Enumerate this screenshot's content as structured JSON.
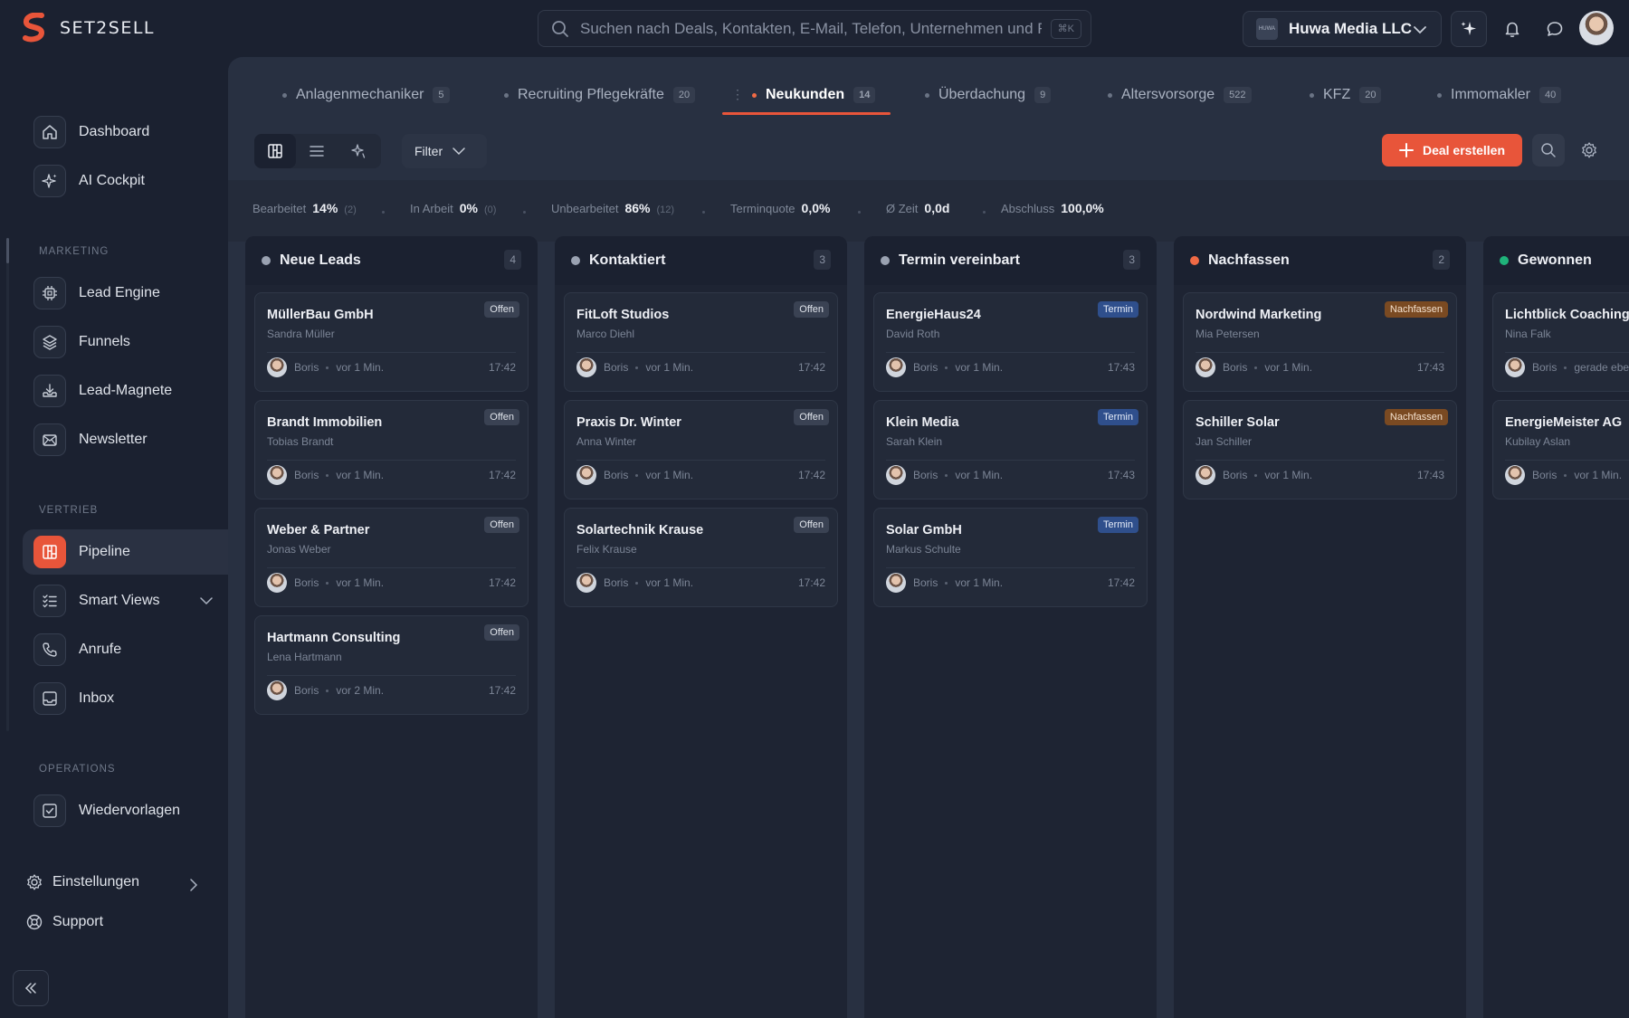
{
  "app": {
    "name": "SET2SELL"
  },
  "search": {
    "placeholder": "Suchen nach Deals, Kontakten, E-Mail, Telefon, Unternehmen und Fi",
    "shortcut": "⌘K"
  },
  "org": {
    "name": "Huwa Media LLC",
    "logo_text": "HUWA"
  },
  "sidebar": {
    "items": [
      {
        "label": "Dashboard"
      },
      {
        "label": "AI Cockpit"
      },
      {
        "label": "Lead Engine"
      },
      {
        "label": "Funnels"
      },
      {
        "label": "Lead-Magnete"
      },
      {
        "label": "Newsletter"
      },
      {
        "label": "Pipeline"
      },
      {
        "label": "Smart Views"
      },
      {
        "label": "Anrufe"
      },
      {
        "label": "Inbox"
      },
      {
        "label": "Wiedervorlagen"
      }
    ],
    "sections": {
      "marketing": "MARKETING",
      "vertrieb": "VERTRIEB",
      "operations": "OPERATIONS"
    },
    "settings": "Einstellungen",
    "support": "Support"
  },
  "tabs": [
    {
      "label": "Anlagenmechaniker",
      "count": "5"
    },
    {
      "label": "Recruiting Pflegekräfte",
      "count": "20"
    },
    {
      "label": "Neukunden",
      "count": "14",
      "active": true
    },
    {
      "label": "Überdachung",
      "count": "9"
    },
    {
      "label": "Altersvorsorge",
      "count": "522"
    },
    {
      "label": "KFZ",
      "count": "20"
    },
    {
      "label": "Immomakler",
      "count": "40"
    }
  ],
  "toolbar": {
    "filter": "Filter",
    "create": "Deal erstellen"
  },
  "stats": [
    {
      "label": "Bearbeitet",
      "value": "14%",
      "extra": "(2)"
    },
    {
      "label": "In Arbeit",
      "value": "0%",
      "extra": "(0)"
    },
    {
      "label": "Unbearbeitet",
      "value": "86%",
      "extra": "(12)"
    },
    {
      "label": "Terminquote",
      "value": "0,0%",
      "extra": ""
    },
    {
      "label": "Ø Zeit",
      "value": "0,0d",
      "extra": ""
    },
    {
      "label": "Abschluss",
      "value": "100,0%",
      "extra": ""
    }
  ],
  "colors": {
    "accent": "#e8553a",
    "gray": "#9aa2b1",
    "orange": "#f06a45",
    "green": "#1fb37a"
  },
  "columns": [
    {
      "title": "Neue Leads",
      "count": "4",
      "cards": [
        {
          "title": "MüllerBau GmbH",
          "contact": "Sandra Müller",
          "badge": "Offen",
          "owner": "Boris",
          "ago": "vor 1 Min.",
          "time": "17:42"
        },
        {
          "title": "Brandt Immobilien",
          "contact": "Tobias Brandt",
          "badge": "Offen",
          "owner": "Boris",
          "ago": "vor 1 Min.",
          "time": "17:42"
        },
        {
          "title": "Weber & Partner",
          "contact": "Jonas Weber",
          "badge": "Offen",
          "owner": "Boris",
          "ago": "vor 1 Min.",
          "time": "17:42"
        },
        {
          "title": "Hartmann Consulting",
          "contact": "Lena Hartmann",
          "badge": "Offen",
          "owner": "Boris",
          "ago": "vor 2 Min.",
          "time": "17:42"
        }
      ]
    },
    {
      "title": "Kontaktiert",
      "count": "3",
      "cards": [
        {
          "title": "FitLoft Studios",
          "contact": "Marco Diehl",
          "badge": "Offen",
          "owner": "Boris",
          "ago": "vor 1 Min.",
          "time": "17:42"
        },
        {
          "title": "Praxis Dr. Winter",
          "contact": "Anna Winter",
          "badge": "Offen",
          "owner": "Boris",
          "ago": "vor 1 Min.",
          "time": "17:42"
        },
        {
          "title": "Solartechnik Krause",
          "contact": "Felix Krause",
          "badge": "Offen",
          "owner": "Boris",
          "ago": "vor 1 Min.",
          "time": "17:42"
        }
      ]
    },
    {
      "title": "Termin vereinbart",
      "count": "3",
      "cards": [
        {
          "title": "EnergieHaus24",
          "contact": "David Roth",
          "badge": "Termin",
          "owner": "Boris",
          "ago": "vor 1 Min.",
          "time": "17:43"
        },
        {
          "title": "Klein Media",
          "contact": "Sarah Klein",
          "badge": "Termin",
          "owner": "Boris",
          "ago": "vor 1 Min.",
          "time": "17:43"
        },
        {
          "title": "Solar GmbH",
          "contact": "Markus Schulte",
          "badge": "Termin",
          "owner": "Boris",
          "ago": "vor 1 Min.",
          "time": "17:42"
        }
      ]
    },
    {
      "title": "Nachfassen",
      "count": "2",
      "cards": [
        {
          "title": "Nordwind Marketing",
          "contact": "Mia Petersen",
          "badge": "Nachfassen",
          "owner": "Boris",
          "ago": "vor 1 Min.",
          "time": "17:43"
        },
        {
          "title": "Schiller Solar",
          "contact": "Jan Schiller",
          "badge": "Nachfassen",
          "owner": "Boris",
          "ago": "vor 1 Min.",
          "time": "17:43"
        }
      ]
    },
    {
      "title": "Gewonnen",
      "count": "",
      "cards": [
        {
          "title": "Lichtblick Coaching",
          "contact": "Nina Falk",
          "badge": "",
          "owner": "Boris",
          "ago": "gerade eben",
          "time": ""
        },
        {
          "title": "EnergieMeister AG",
          "contact": "Kubilay Aslan",
          "badge": "",
          "owner": "Boris",
          "ago": "vor 1 Min.",
          "time": ""
        }
      ]
    }
  ]
}
